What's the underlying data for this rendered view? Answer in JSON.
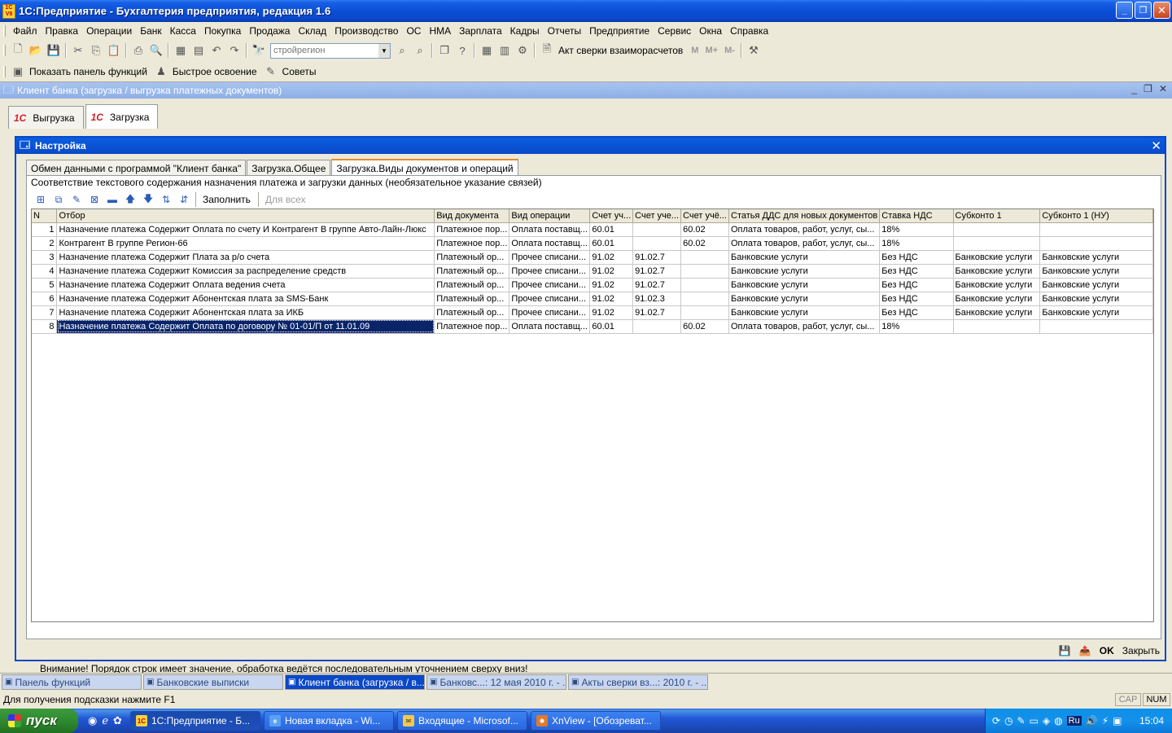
{
  "window": {
    "title": "1С:Предприятие - Бухгалтерия предприятия, редакция 1.6",
    "app_icon": "1С V8"
  },
  "menu": [
    "Файл",
    "Правка",
    "Операции",
    "Банк",
    "Касса",
    "Покупка",
    "Продажа",
    "Склад",
    "Производство",
    "ОС",
    "НМА",
    "Зарплата",
    "Кадры",
    "Отчеты",
    "Предприятие",
    "Сервис",
    "Окна",
    "Справка"
  ],
  "toolbar": {
    "search_value": "стройрегион",
    "akt_label": "Акт сверки взаиморасчетов",
    "m_buttons": [
      "M",
      "M+",
      "M-"
    ]
  },
  "toolbar2": {
    "show_panel": "Показать панель функций",
    "quick_learn": "Быстрое освоение",
    "tips": "Советы"
  },
  "mdi": {
    "title": "Клиент банка (загрузка / выгрузка платежных документов)"
  },
  "top_tabs": [
    {
      "label": "Выгрузка",
      "logo": "1С"
    },
    {
      "label": "Загрузка",
      "logo": "1С"
    }
  ],
  "dialog": {
    "title": "Настройка",
    "tabs": [
      "Обмен данными с программой \"Клиент банка\"",
      "Загрузка.Общее",
      "Загрузка.Виды документов и операций"
    ],
    "caption": "Соответствие текстового содержания назначения платежа и загрузки данных (необязательное указание связей)",
    "fill_label": "Заполнить",
    "for_all_label": "Для всех",
    "footnote": "Внимание! Порядок строк имеет значение, обработка ведётся последовательным уточнением сверху вниз!",
    "ok_label": "OK",
    "close_label": "Закрыть"
  },
  "table": {
    "columns": [
      "N",
      "Отбор",
      "Вид документа",
      "Вид операции",
      "Счет уч...",
      "Счет уче...",
      "Счет учё...",
      "Статья ДДС для новых документов",
      "Ставка НДС",
      "Субконто 1",
      "Субконто 1 (НУ)"
    ],
    "rows": [
      [
        "1",
        "Назначение платежа Содержит Оплата по счету И Контрагент В группе Авто-Лайн-Люкс",
        "Платежное пор...",
        "Оплата поставщ...",
        "60.01",
        "",
        "60.02",
        "Оплата товаров, работ, услуг, сы...",
        "18%",
        "",
        ""
      ],
      [
        "2",
        "Контрагент В группе Регион-66",
        "Платежное пор...",
        "Оплата поставщ...",
        "60.01",
        "",
        "60.02",
        "Оплата товаров, работ, услуг, сы...",
        "18%",
        "",
        ""
      ],
      [
        "3",
        "Назначение платежа Содержит Плата за р/о счета",
        "Платежный ор...",
        "Прочее списани...",
        "91.02",
        "91.02.7",
        "",
        "Банковские услуги",
        "Без НДС",
        "Банковские услуги",
        "Банковские услуги"
      ],
      [
        "4",
        "Назначение платежа Содержит Комиссия за распределение средств",
        "Платежный ор...",
        "Прочее списани...",
        "91.02",
        "91.02.7",
        "",
        "Банковские услуги",
        "Без НДС",
        "Банковские услуги",
        "Банковские услуги"
      ],
      [
        "5",
        "Назначение платежа Содержит Оплата ведения счета",
        "Платежный ор...",
        "Прочее списани...",
        "91.02",
        "91.02.7",
        "",
        "Банковские услуги",
        "Без НДС",
        "Банковские услуги",
        "Банковские услуги"
      ],
      [
        "6",
        "Назначение платежа Содержит Абонентская плата за SMS-Банк",
        "Платежный ор...",
        "Прочее списани...",
        "91.02",
        "91.02.3",
        "",
        "Банковские услуги",
        "Без НДС",
        "Банковские услуги",
        "Банковские услуги"
      ],
      [
        "7",
        "Назначение платежа Содержит Абонентская плата за ИКБ",
        "Платежный ор...",
        "Прочее списани...",
        "91.02",
        "91.02.7",
        "",
        "Банковские услуги",
        "Без НДС",
        "Банковские услуги",
        "Банковские услуги"
      ],
      [
        "8",
        "Назначение платежа Содержит Оплата по договору № 01-01/П от 11.01.09",
        "Платежное пор...",
        "Оплата поставщ...",
        "60.01",
        "",
        "60.02",
        "Оплата товаров, работ, услуг, сы...",
        "18%",
        "",
        ""
      ]
    ],
    "selected_row": 7
  },
  "window_tabs": [
    "Панель функций",
    "Банковские выписки",
    "Клиент банка (загрузка / в...",
    "Банковс...: 12 мая 2010 г. - ...",
    "Акты сверки вз...: 2010 г. - ..."
  ],
  "window_tab_active": 2,
  "status": {
    "hint": "Для получения подсказки нажмите F1",
    "cap": "CAP",
    "num": "NUM"
  },
  "taskbar": {
    "start": "пуск",
    "tasks": [
      "1С:Предприятие - Б...",
      "Новая вкладка - Wi...",
      "Входящие - Microsof...",
      "XnView - [Обозреват..."
    ],
    "active_task": 0,
    "lang": "Ru",
    "clock": "15:04"
  }
}
